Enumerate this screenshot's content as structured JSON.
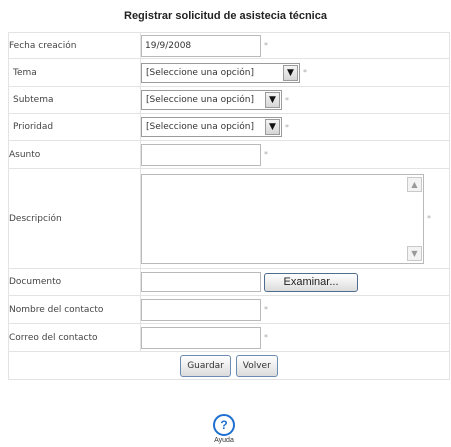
{
  "title": "Registrar solicitud de asistecia técnica",
  "required_mark": "*",
  "fields": {
    "fecha": {
      "label": "Fecha creación",
      "value": "19/9/2008"
    },
    "tema": {
      "label": "Tema",
      "selected": "[Seleccione una opción]"
    },
    "subtema": {
      "label": "Subtema",
      "selected": "[Seleccione una opción]"
    },
    "prioridad": {
      "label": "Prioridad",
      "selected": "[Seleccione una opción]"
    },
    "asunto": {
      "label": "Asunto",
      "value": ""
    },
    "descripcion": {
      "label": "Descripción",
      "value": ""
    },
    "documento": {
      "label": "Documento",
      "value": "",
      "browse_label": "Examinar..."
    },
    "nombre_contacto": {
      "label": "Nombre del contacto",
      "value": ""
    },
    "correo_contacto": {
      "label": "Correo del contacto",
      "value": ""
    }
  },
  "actions": {
    "save_label": "Guardar",
    "back_label": "Volver"
  },
  "help": {
    "icon": "question-icon",
    "label": "Ayuda",
    "accent": "#1f6fd0"
  }
}
